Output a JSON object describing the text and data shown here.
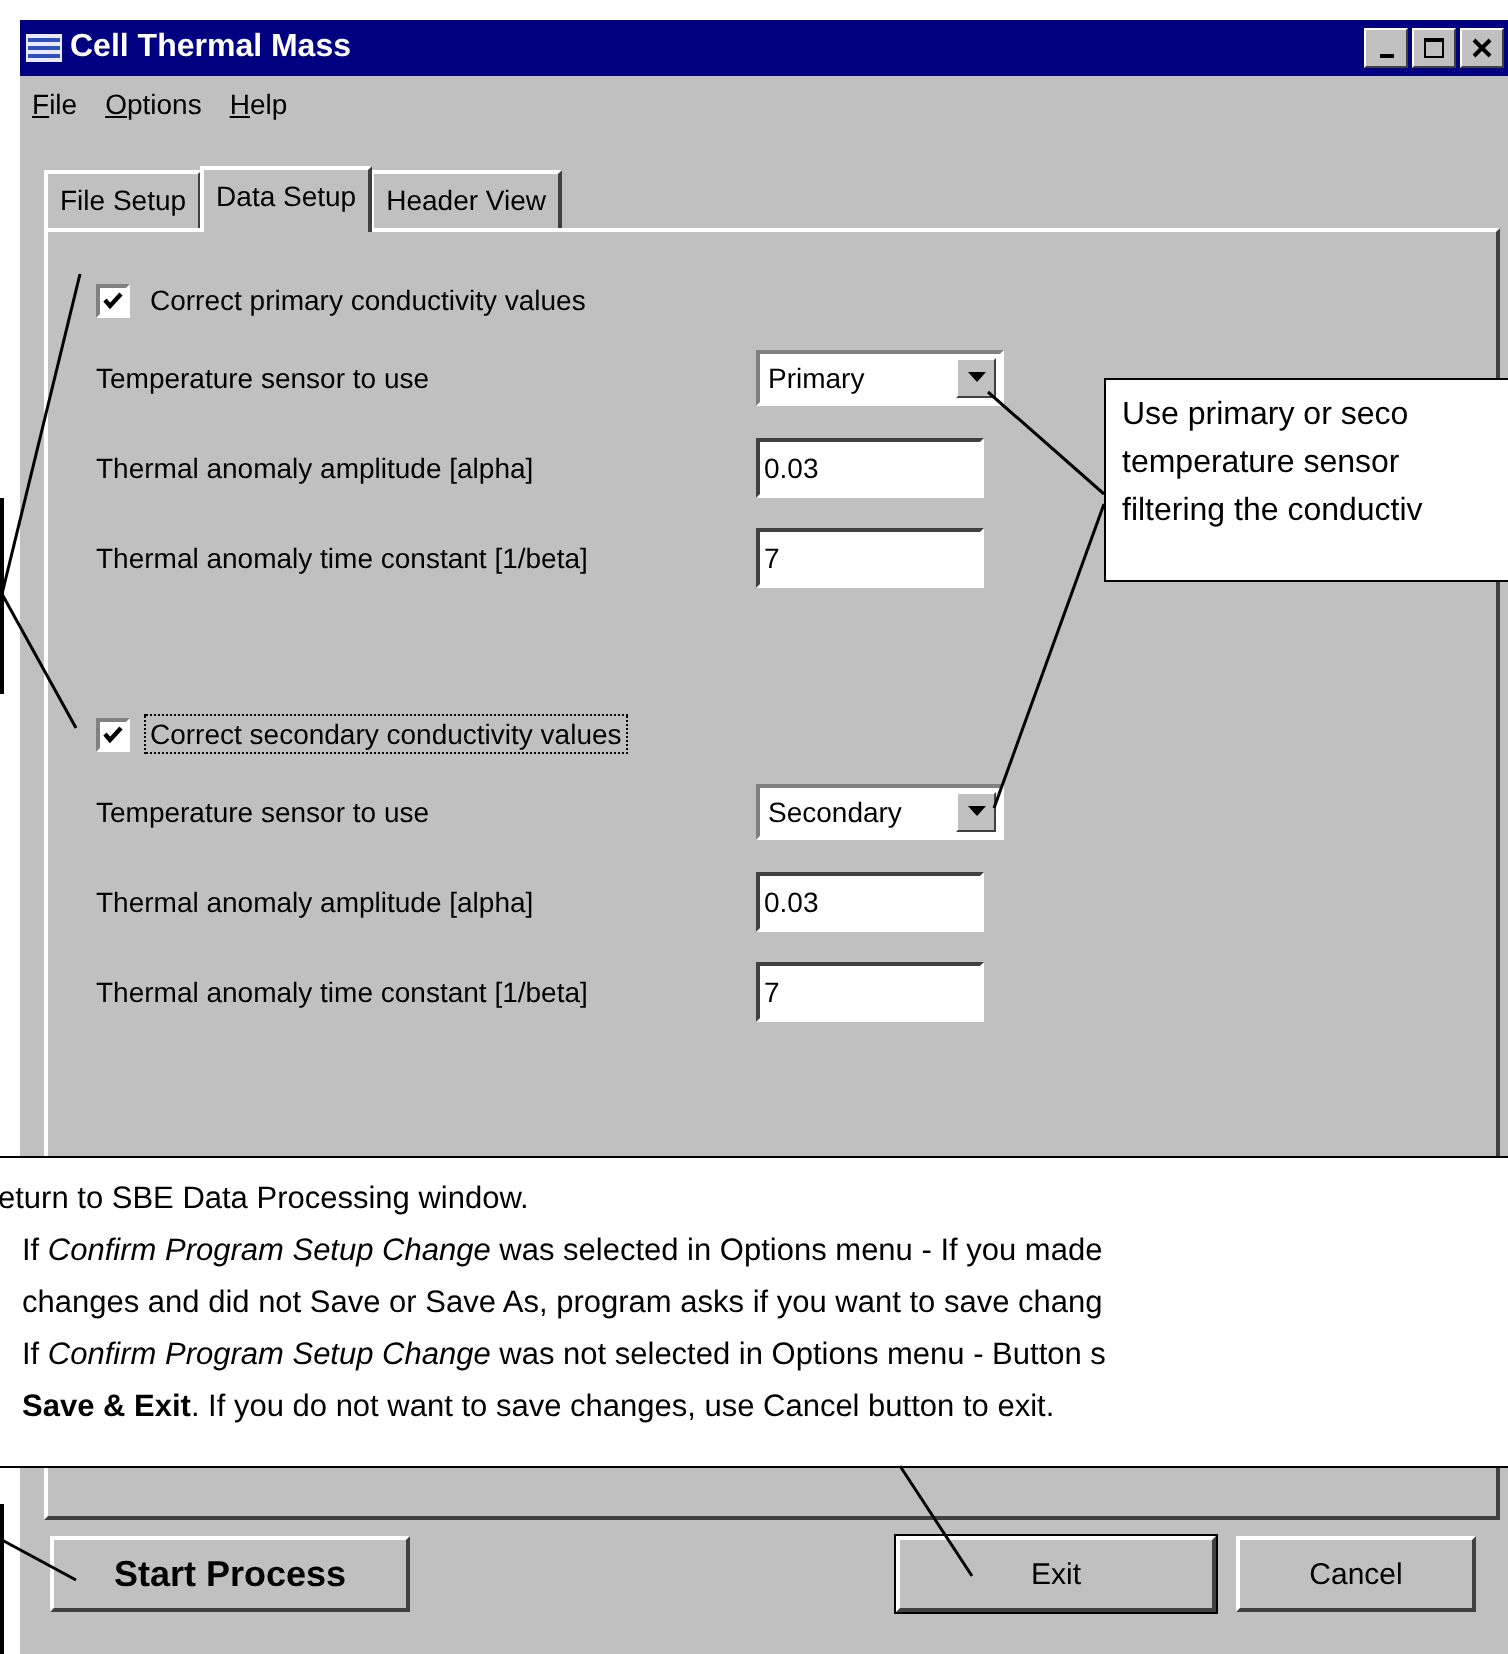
{
  "window": {
    "title": "Cell Thermal Mass"
  },
  "menu": [
    {
      "label": "File"
    },
    {
      "label": "Options"
    },
    {
      "label": "Help"
    }
  ],
  "tabs": [
    {
      "label": "File Setup",
      "selected": false
    },
    {
      "label": "Data Setup",
      "selected": true
    },
    {
      "label": "Header View",
      "selected": false
    }
  ],
  "groups": [
    {
      "label": "Correct primary conductivity values",
      "checked": true,
      "focused": false,
      "fields": [
        {
          "kind": "dropdown",
          "label": "Temperature sensor to use",
          "value": "Primary"
        },
        {
          "kind": "text",
          "label": "Thermal anomaly amplitude [alpha]",
          "value": "0.03"
        },
        {
          "kind": "text",
          "label": "Thermal anomaly time constant [1/beta]",
          "value": "7"
        }
      ]
    },
    {
      "label": "Correct secondary conductivity values",
      "checked": true,
      "focused": true,
      "fields": [
        {
          "kind": "dropdown",
          "label": "Temperature sensor to use",
          "value": "Secondary"
        },
        {
          "kind": "text",
          "label": "Thermal anomaly amplitude [alpha]",
          "value": "0.03"
        },
        {
          "kind": "text",
          "label": "Thermal anomaly time constant [1/beta]",
          "value": "7"
        }
      ]
    }
  ],
  "callouts": [
    {
      "kind": "side",
      "lines": [
        "Use primary or seco",
        "temperature sensor",
        "filtering the conductiv"
      ]
    },
    {
      "kind": "wide",
      "lines": [
        "eturn to SBE Data Processing window.",
        "If *Confirm Program Setup Change* was selected in Options menu - If you made",
        "changes and did not Save or Save As, program asks if you want to save chang",
        "If *Confirm Program Setup Change* was not selected in Options menu - Button s",
        "**Save & Exit**. If you do not want to save changes, use Cancel button to exit."
      ]
    }
  ],
  "buttons": [
    {
      "label": "Start Process",
      "default": false,
      "kind": "process"
    },
    {
      "label": "Exit",
      "default": true,
      "kind": "normal"
    },
    {
      "label": "Cancel",
      "default": false,
      "kind": "normal"
    }
  ]
}
